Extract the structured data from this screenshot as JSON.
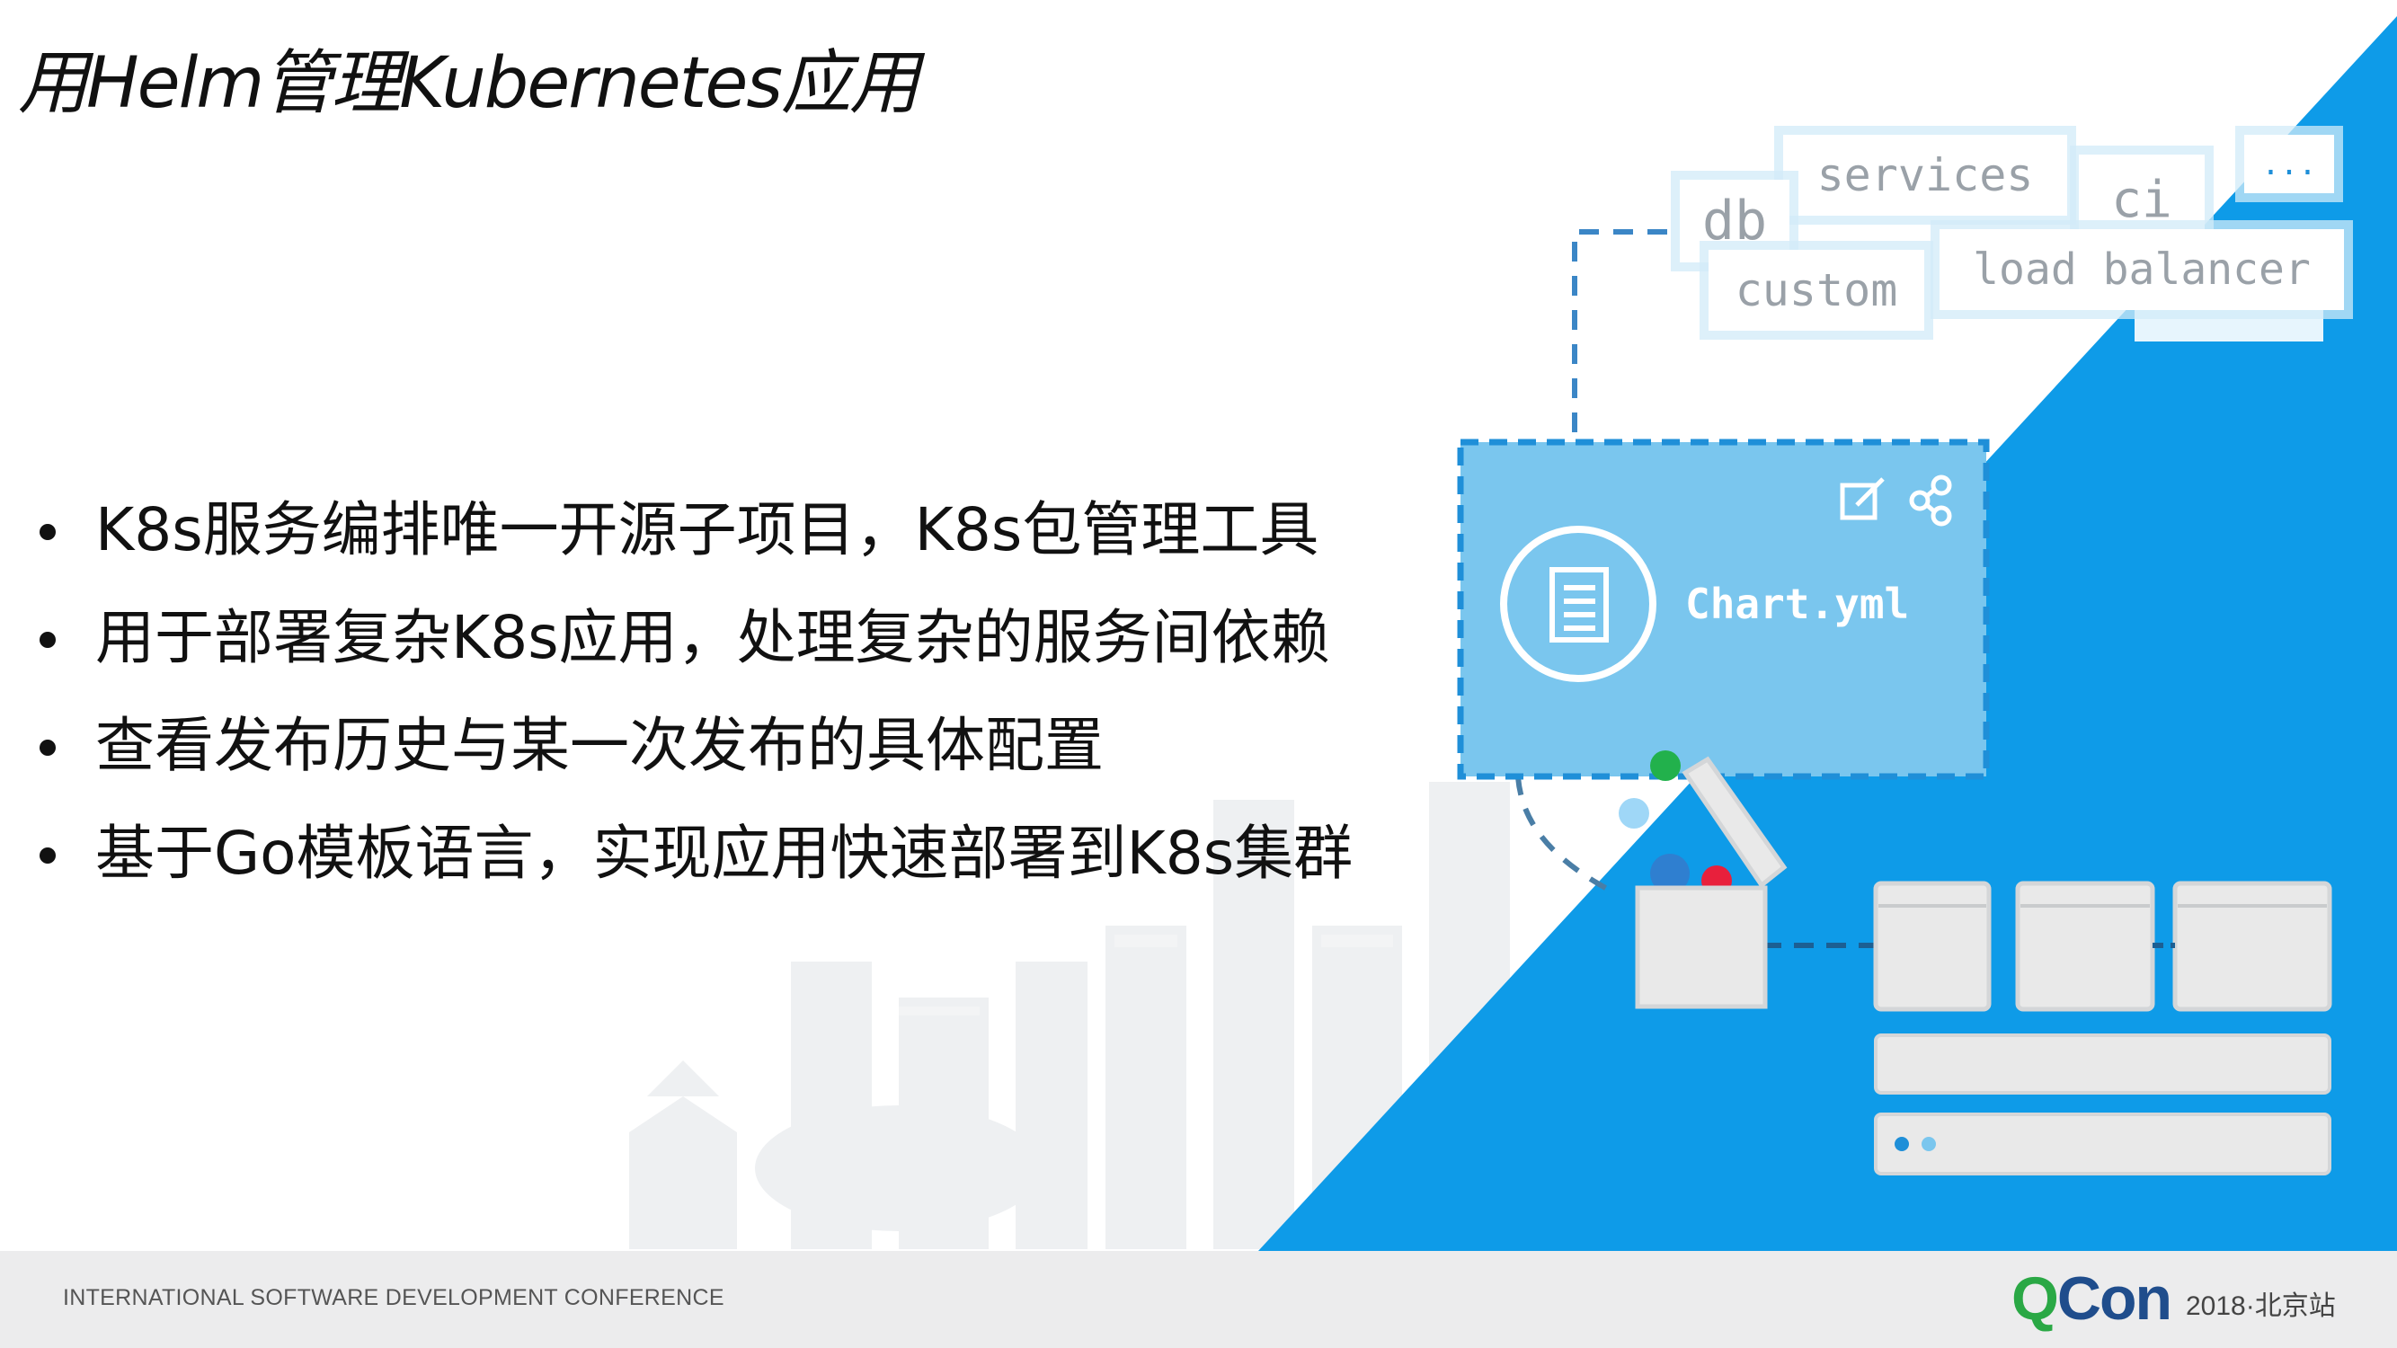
{
  "title": "用Helm管理Kubernetes应用",
  "bullets": [
    "K8s服务编排唯一开源子项目，K8s包管理工具",
    "用于部署复杂K8s应用，处理复杂的服务间依赖",
    "查看发布历史与某一次发布的具体配置",
    "基于Go模板语言，实现应用快速部署到K8s集群"
  ],
  "diagram": {
    "tags": {
      "db": "db",
      "services": "services",
      "ci": "ci",
      "more": "...",
      "custom": "custom",
      "load_balancer": "load balancer"
    },
    "chart_file": "Chart.yml",
    "accent_color": "#0e9be8",
    "box_color": "#7ac6ee"
  },
  "footer": {
    "conference": "INTERNATIONAL SOFTWARE DEVELOPMENT CONFERENCE",
    "logo_q": "Q",
    "logo_con": "Con",
    "edition": "2018·北京站"
  }
}
